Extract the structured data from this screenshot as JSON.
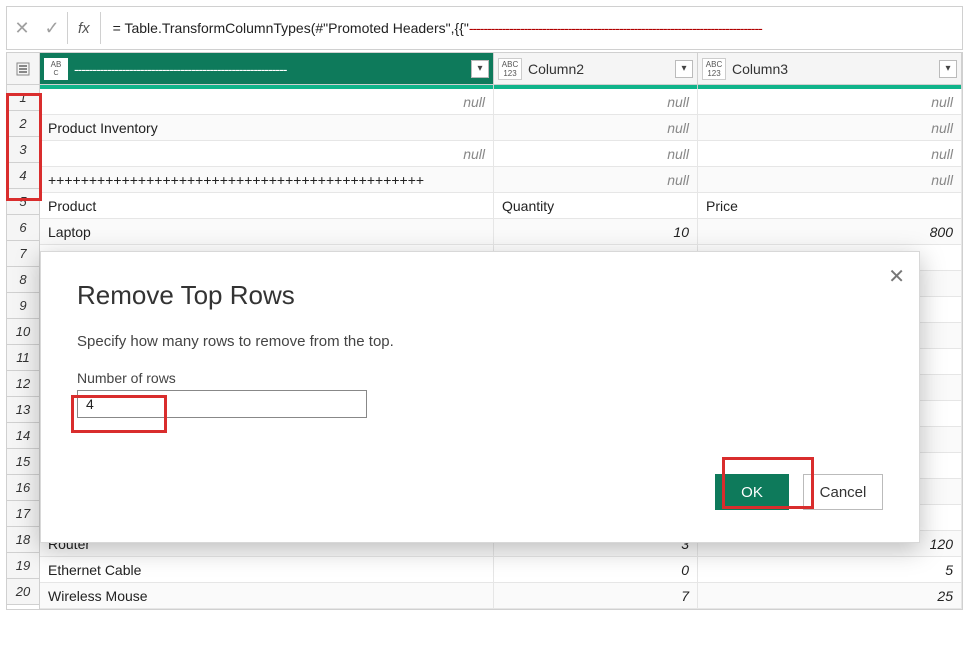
{
  "formula_bar": {
    "fx_label": "fx",
    "formula_prefix": "= Table.TransformColumnTypes(#\"Promoted Headers\",{{\"",
    "formula_dashes": "--------------------------------------------------------------------------------"
  },
  "columns": [
    {
      "type_top": "AB",
      "type_bot": "C",
      "label": "----------------------------------------------------------"
    },
    {
      "type_top": "ABC",
      "type_bot": "123",
      "label": "Column2"
    },
    {
      "type_top": "ABC",
      "type_bot": "123",
      "label": "Column3"
    }
  ],
  "rows": [
    {
      "n": "1",
      "c1": "",
      "c1null": true,
      "c2": "null",
      "c3": "null"
    },
    {
      "n": "2",
      "c1": "Product Inventory",
      "c1null": false,
      "c2": "null",
      "c3": "null"
    },
    {
      "n": "3",
      "c1": "",
      "c1null": true,
      "c2": "null",
      "c3": "null"
    },
    {
      "n": "4",
      "c1": "++++++++++++++++++++++++++++++++++++++++++++++",
      "c1null": false,
      "c2": "null",
      "c3": "null"
    },
    {
      "n": "5",
      "c1": "Product",
      "c1null": false,
      "c2": "Quantity",
      "c2text": true,
      "c3": "Price",
      "c3text": true
    },
    {
      "n": "6",
      "c1": "Laptop",
      "c1null": false,
      "c2": "10",
      "c2num": true,
      "c3": "800",
      "c3num": true
    },
    {
      "n": "7",
      "c1": "",
      "c1null": false,
      "c2": "",
      "c3": ""
    },
    {
      "n": "8",
      "c1": "",
      "c1null": false,
      "c2": "",
      "c3": ""
    },
    {
      "n": "9",
      "c1": "",
      "c1null": false,
      "c2": "",
      "c3": ""
    },
    {
      "n": "10",
      "c1": "",
      "c1null": false,
      "c2": "",
      "c3": ""
    },
    {
      "n": "11",
      "c1": "",
      "c1null": false,
      "c2": "",
      "c3": ""
    },
    {
      "n": "12",
      "c1": "",
      "c1null": false,
      "c2": "",
      "c3": ""
    },
    {
      "n": "13",
      "c1": "",
      "c1null": false,
      "c2": "",
      "c3": ""
    },
    {
      "n": "14",
      "c1": "",
      "c1null": false,
      "c2": "",
      "c3": ""
    },
    {
      "n": "15",
      "c1": "",
      "c1null": false,
      "c2": "",
      "c3": ""
    },
    {
      "n": "16",
      "c1": "",
      "c1null": false,
      "c2": "",
      "c3": ""
    },
    {
      "n": "17",
      "c1": "",
      "c1null": false,
      "c2": "",
      "c3": ""
    },
    {
      "n": "18",
      "c1": "Router",
      "c1null": false,
      "c2": "3",
      "c2num": true,
      "c3": "120",
      "c3num": true
    },
    {
      "n": "19",
      "c1": "Ethernet Cable",
      "c1null": false,
      "c2": "0",
      "c2num": true,
      "c3": "5",
      "c3num": true
    },
    {
      "n": "20",
      "c1": "Wireless Mouse",
      "c1null": false,
      "c2": "7",
      "c2num": true,
      "c3": "25",
      "c3num": true
    }
  ],
  "dialog": {
    "title": "Remove Top Rows",
    "subtitle": "Specify how many rows to remove from the top.",
    "field_label": "Number of rows",
    "field_value": "4",
    "ok": "OK",
    "cancel": "Cancel"
  }
}
